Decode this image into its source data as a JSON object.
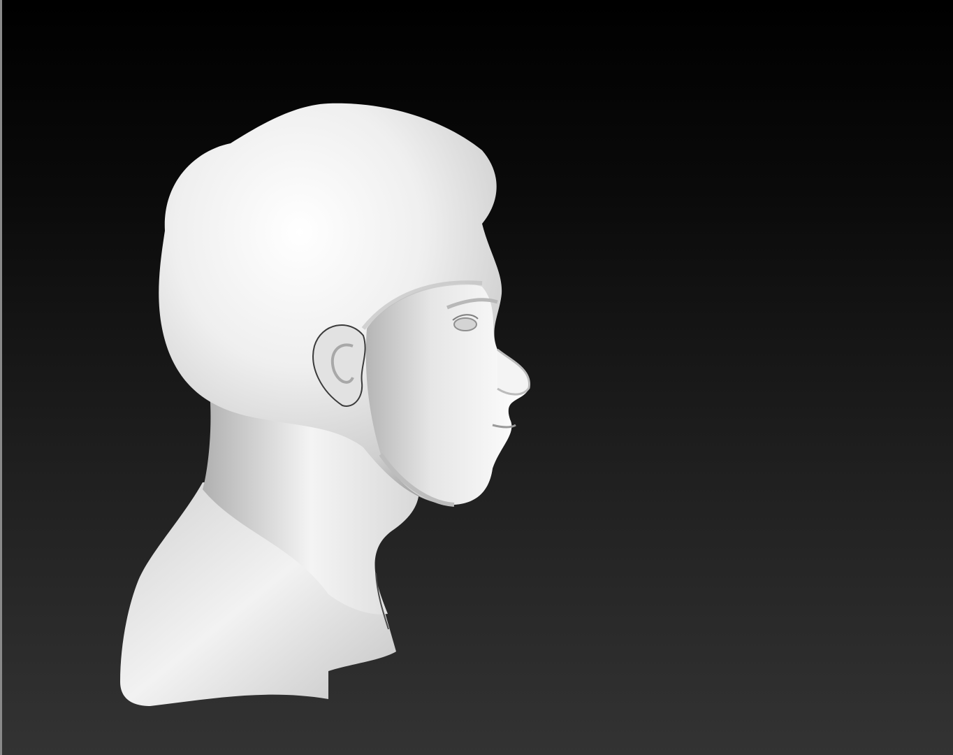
{
  "viewport": {
    "background_top": "#000000",
    "background_bottom": "#333333"
  },
  "model": {
    "icon": "sculpted-head-bust",
    "material_color": "#ececec",
    "shadow_color": "#9a9a9a"
  }
}
